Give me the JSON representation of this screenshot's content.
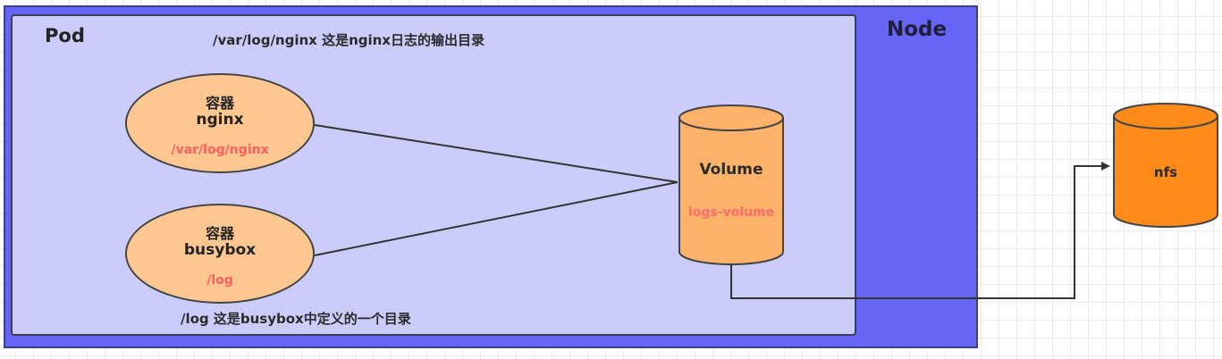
{
  "node": {
    "label": "Node"
  },
  "pod": {
    "label": "Pod"
  },
  "notes": {
    "nginx_dir": "/var/log/nginx 这是nginx日志的输出目录",
    "busybox_dir": "/log 这是busybox中定义的一个目录"
  },
  "containers": [
    {
      "kind": "容器",
      "name": "nginx",
      "path": "/var/log/nginx"
    },
    {
      "kind": "容器",
      "name": "busybox",
      "path": "/log"
    }
  ],
  "volume": {
    "title": "Volume",
    "name": "logs-volume"
  },
  "nfs": {
    "label": "nfs"
  },
  "colors": {
    "node_fill": "#6565f6",
    "pod_fill": "#ccccfa",
    "container_fill": "#fec792",
    "volume_fill": "#fdb26a",
    "nfs_fill": "#ff8c1a",
    "path_text": "#ff5c5c"
  }
}
